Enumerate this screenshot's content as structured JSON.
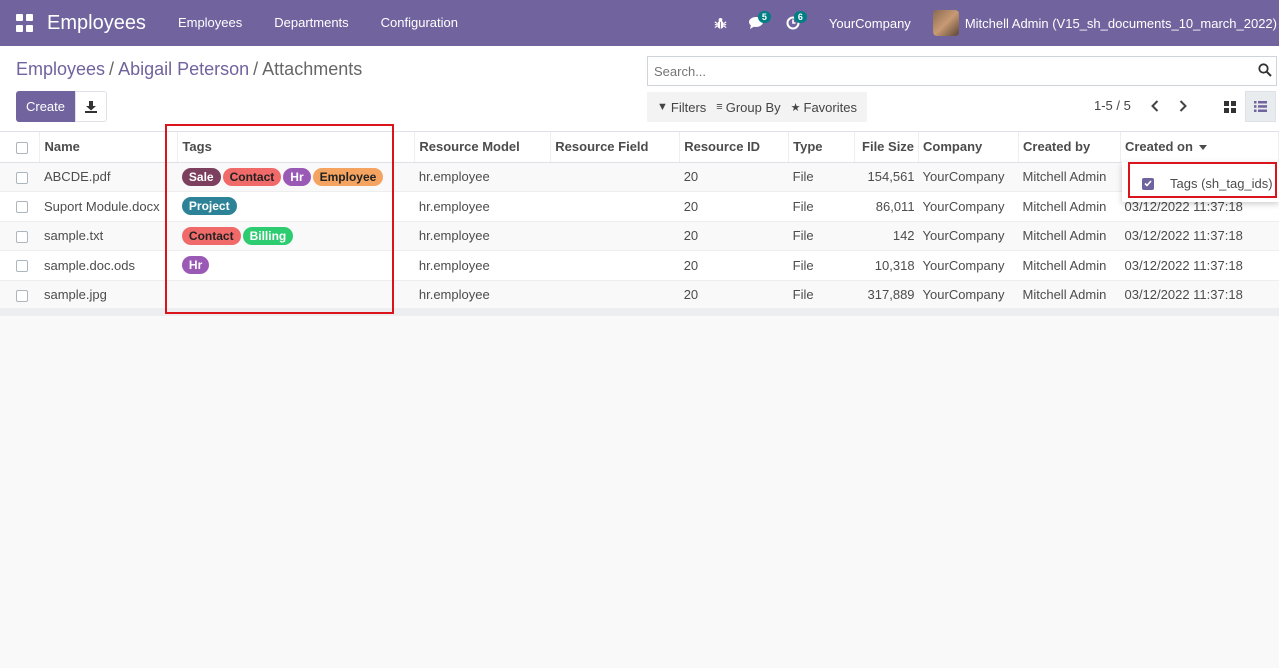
{
  "navbar": {
    "app_title": "Employees",
    "menu": [
      "Employees",
      "Departments",
      "Configuration"
    ],
    "messages_badge": "5",
    "activities_badge": "6",
    "company": "YourCompany",
    "user": "Mitchell Admin (V15_sh_documents_10_march_2022)"
  },
  "breadcrumb": {
    "crumbs": [
      "Employees",
      "Abigail Peterson"
    ],
    "current": "Attachments"
  },
  "toolbar": {
    "create_label": "Create",
    "search_placeholder": "Search...",
    "filters_label": "Filters",
    "groupby_label": "Group By",
    "favorites_label": "Favorites",
    "pager": "1-5 / 5"
  },
  "table": {
    "columns": [
      "Name",
      "Tags",
      "Resource Model",
      "Resource Field",
      "Resource ID",
      "Type",
      "File Size",
      "Company",
      "Created by",
      "Created on"
    ],
    "rows": [
      {
        "name": "ABCDE.pdf",
        "tags": [
          {
            "label": "Sale",
            "color": "#7c3f5e"
          },
          {
            "label": "Contact",
            "color": "#f06a6a"
          },
          {
            "label": "Hr",
            "color": "#9b59b6"
          },
          {
            "label": "Employee",
            "color": "#f4a460"
          }
        ],
        "model": "hr.employee",
        "field": "",
        "res_id": "20",
        "type": "File",
        "size": "154,561",
        "company": "YourCompany",
        "created_by": "Mitchell Admin",
        "created_on": ""
      },
      {
        "name": "Suport Module.docx",
        "tags": [
          {
            "label": "Project",
            "color": "#2c8397"
          }
        ],
        "model": "hr.employee",
        "field": "",
        "res_id": "20",
        "type": "File",
        "size": "86,011",
        "company": "YourCompany",
        "created_by": "Mitchell Admin",
        "created_on": "03/12/2022 11:37:18"
      },
      {
        "name": "sample.txt",
        "tags": [
          {
            "label": "Contact",
            "color": "#f06a6a"
          },
          {
            "label": "Billing",
            "color": "#2ecc71"
          }
        ],
        "model": "hr.employee",
        "field": "",
        "res_id": "20",
        "type": "File",
        "size": "142",
        "company": "YourCompany",
        "created_by": "Mitchell Admin",
        "created_on": "03/12/2022 11:37:18"
      },
      {
        "name": "sample.doc.ods",
        "tags": [
          {
            "label": "Hr",
            "color": "#9b59b6"
          }
        ],
        "model": "hr.employee",
        "field": "",
        "res_id": "20",
        "type": "File",
        "size": "10,318",
        "company": "YourCompany",
        "created_by": "Mitchell Admin",
        "created_on": "03/12/2022 11:37:18"
      },
      {
        "name": "sample.jpg",
        "tags": [],
        "model": "hr.employee",
        "field": "",
        "res_id": "20",
        "type": "File",
        "size": "317,889",
        "company": "YourCompany",
        "created_by": "Mitchell Admin",
        "created_on": "03/12/2022 11:37:18"
      }
    ]
  },
  "optional_columns": {
    "item_label": "Tags (sh_tag_ids)"
  },
  "colors": {
    "brand": "#71639e",
    "highlight": "#d9141b"
  }
}
